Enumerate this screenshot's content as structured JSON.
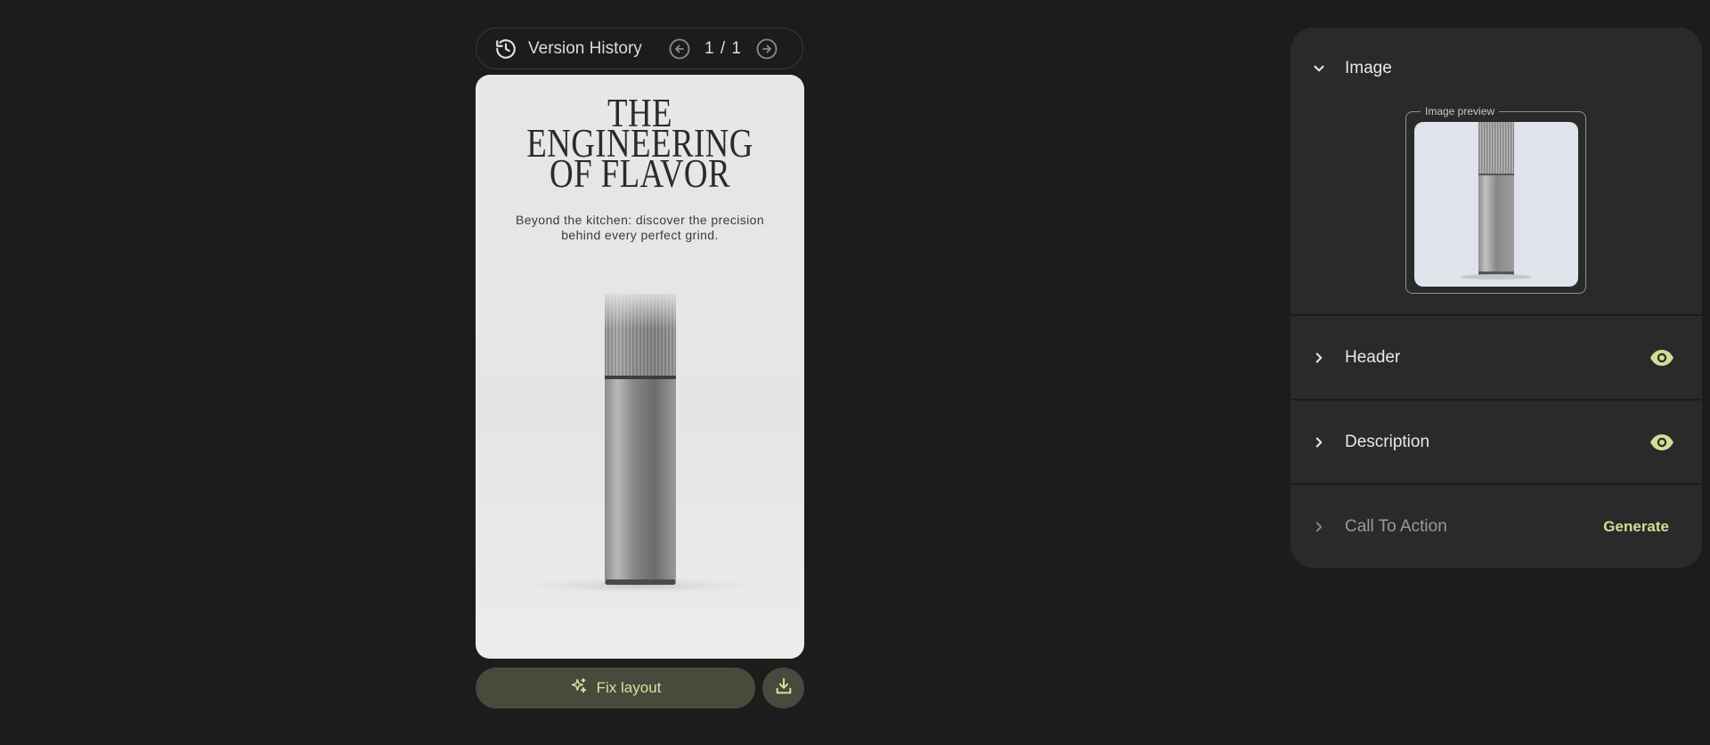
{
  "version_history": {
    "title": "Version History",
    "count": "1 / 1",
    "icons": [
      "history-icon",
      "arrow-left-circle-icon",
      "arrow-right-circle-icon"
    ]
  },
  "preview": {
    "headline_lines": [
      "THE",
      "ENGINEERING",
      "OF FLAVOR"
    ],
    "subtext_line1": "Beyond the kitchen: discover the precision",
    "subtext_line2": "behind every perfect grind."
  },
  "actions": {
    "fix_layout_label": "Fix layout",
    "icons": [
      "sparkle-icon",
      "download-icon"
    ]
  },
  "panel": {
    "sections": [
      {
        "label": "Image",
        "expanded": true,
        "preview_label": "Image preview"
      },
      {
        "label": "Header",
        "expanded": false,
        "visible": true
      },
      {
        "label": "Description",
        "expanded": false,
        "visible": true
      },
      {
        "label": "Call To Action",
        "expanded": false,
        "action_label": "Generate"
      }
    ]
  },
  "colors": {
    "background": "#1c1c1c",
    "panel": "#2a2a2b",
    "accent": "#d3dc94",
    "button": "#484a3c"
  }
}
